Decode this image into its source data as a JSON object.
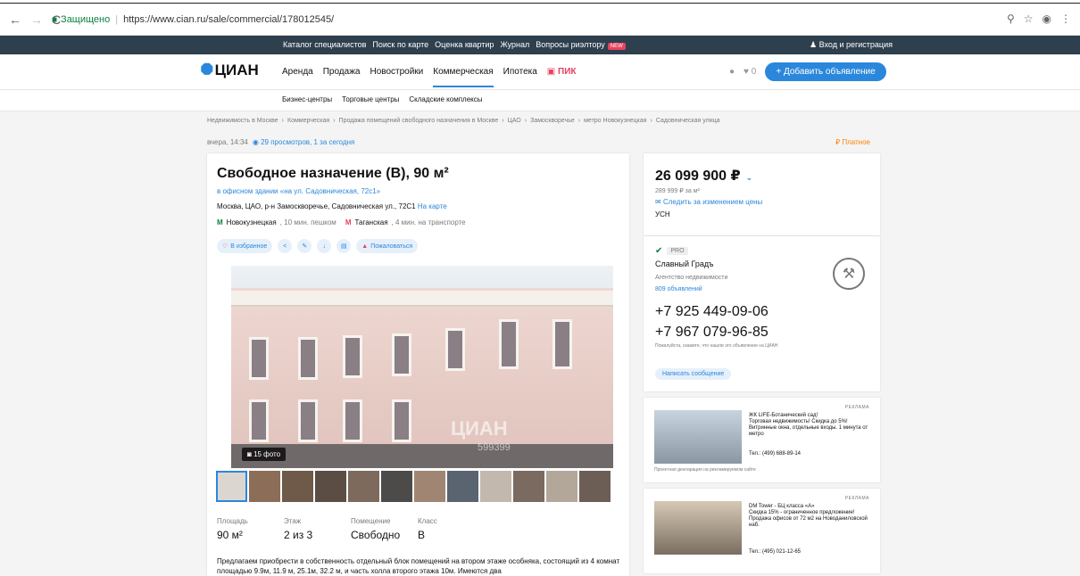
{
  "browser": {
    "secure": "Защищено",
    "url": "https://www.cian.ru/sale/commercial/178012545/"
  },
  "topbar": {
    "links": [
      "Каталог специалистов",
      "Поиск по карте",
      "Оценка квартир",
      "Журнал",
      "Вопросы риэлтору"
    ],
    "new_badge": "NEW",
    "login": "Вход и регистрация"
  },
  "nav": {
    "logo": "ЦИАН",
    "items": [
      "Аренда",
      "Продажа",
      "Новостройки",
      "Коммерческая",
      "Ипотека"
    ],
    "pik": "ПИК",
    "favorites_count": "0",
    "add_button": "+ Добавить объявление"
  },
  "subnav": [
    "Бизнес-центры",
    "Торговые центры",
    "Складские комплексы"
  ],
  "breadcrumbs": [
    "Недвижимость в Москве",
    "Коммерческая",
    "Продажа помещений свободного назначения в Москве",
    "ЦАО",
    "Замоскворечье",
    "метро Новокузнецкая",
    "Садовническая улица"
  ],
  "meta": {
    "date": "вчера, 14:34",
    "views": "29 просмотров, 1 за сегодня",
    "paid": "Платное"
  },
  "listing": {
    "title": "Свободное назначение (B), 90 м²",
    "building": "в офисном здании «на ул. Садовническая, 72с1»",
    "address": "Москва, ЦАО, р-н Замоскворечье, Садовническая ул., 72С1",
    "map_link": "На карте",
    "metro1": "Новокузнецкая",
    "metro1_time": ", 10 мин. пешком",
    "metro2": "Таганская",
    "metro2_time": ", 4 мин. на транспорте",
    "fav": "В избранное",
    "complain": "Пожаловаться",
    "photo_count": "15 фото",
    "watermark": "ЦИАН",
    "watermark_id": "599399",
    "facts": [
      {
        "label": "Площадь",
        "value": "90 м²"
      },
      {
        "label": "Этаж",
        "value": "2 из 3"
      },
      {
        "label": "Помещение",
        "value": "Свободно"
      },
      {
        "label": "Класс",
        "value": "B"
      }
    ],
    "description": "Предлагаем приобрести в собственность отдельный блок помещений на втором этаже особняка, состоящий из 4 комнат площадью 9.9м, 11.9 м, 25.1м, 32.2 м, и часть холла второго этажа 10м. Имеются два"
  },
  "price": {
    "value": "26 099 900 ₽",
    "per_m2": "289 999 ₽ за м²",
    "follow": "Следить за изменением цены",
    "tax": "УСН"
  },
  "agent": {
    "pro": "PRO",
    "name": "Славный Градъ",
    "type": "Агентство недвижимости",
    "ads": "809 объявлений",
    "phone1": "+7 925 449-09-06",
    "phone2": "+7 967 079-96-85",
    "note": "Пожалуйста, скажите, что нашли это объявление на ЦИАН",
    "message": "Написать сообщение"
  },
  "ads": [
    {
      "tag": "РЕКЛАМА",
      "title": "ЖК LIFE-Ботанический сад!",
      "text": "Торговая недвижимость! Скидка до 5%! Витринные окна, отдельные входы. 1 минута от метро",
      "phone": "Тел.: (499) 688-89-14",
      "footer": "Проектная декларация на рекламируемом сайте"
    },
    {
      "tag": "РЕКЛАМА",
      "title": "DM Tower - БЦ класса «А»",
      "text": "Скидка 15% - ограниченное предложение! Продажа офисов от 72 м2 на Новоданиловской наб.",
      "phone": "Тел.: (495) 021-12-65",
      "footer": ""
    }
  ]
}
